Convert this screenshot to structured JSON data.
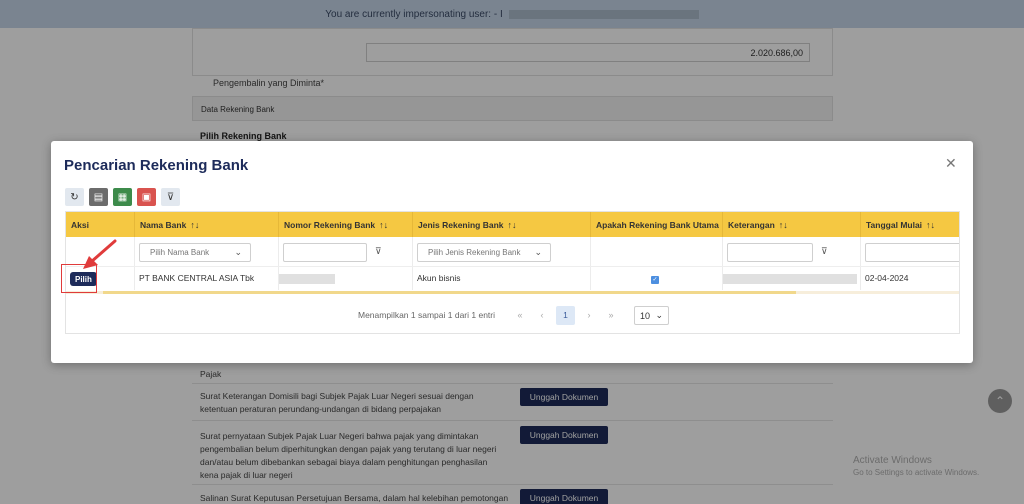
{
  "banner": {
    "text": "You are currently impersonating user: - I"
  },
  "background": {
    "field_label": "Pengembalin yang Diminta*",
    "field_value": "2.020.686,00",
    "section_title": "Data Rekening Bank",
    "section_subtitle": "Pilih Rekening Bank",
    "docs": [
      {
        "text": "Pajak",
        "button": ""
      },
      {
        "text": "Surat Keterangan Domisili bagi Subjek Pajak Luar Negeri sesuai dengan ketentuan peraturan perundang-undangan di bidang perpajakan",
        "button": "Unggah Dokumen"
      },
      {
        "text": "Surat pernyataan Subjek Pajak Luar Negeri bahwa pajak yang dimintakan pengembalian belum diperhitungkan dengan pajak yang terutang di luar negeri dan/atau belum dibebankan sebagai biaya dalam penghitungan penghasilan kena pajak di luar negeri",
        "button": "Unggah Dokumen"
      },
      {
        "text": "Salinan Surat Keputusan Persetujuan Bersama, dalam hal kelebihan pemotongan",
        "button": "Unggah Dokumen"
      }
    ],
    "watermark_title": "Activate Windows",
    "watermark_sub": "Go to Settings to activate Windows."
  },
  "modal": {
    "title": "Pencarian Rekening Bank",
    "close_icon": "close-icon",
    "toolbar": [
      "refresh-icon",
      "file-icon",
      "excel-icon",
      "pdf-icon",
      "filter-clear-icon"
    ],
    "columns": [
      {
        "label": "Aksi",
        "sortable": false
      },
      {
        "label": "Nama Bank",
        "sortable": true
      },
      {
        "label": "Nomor Rekening Bank",
        "sortable": true
      },
      {
        "label": "Jenis Rekening Bank",
        "sortable": true
      },
      {
        "label": "Apakah Rekening Bank Utama",
        "sortable": false
      },
      {
        "label": "Keterangan",
        "sortable": true
      },
      {
        "label": "Tanggal Mulai",
        "sortable": true
      }
    ],
    "filters": {
      "nama_bank_placeholder": "Pilih Nama Bank",
      "jenis_placeholder": "Pilih Jenis Rekening Bank"
    },
    "row": {
      "action": "Pilih",
      "nama_bank": "PT BANK CENTRAL ASIA Tbk",
      "jenis": "Akun bisnis",
      "utama": true,
      "tanggal_mulai": "02-04-2024"
    },
    "pager": {
      "info": "Menampilkan 1 sampai 1 dari 1 entri",
      "first": "«",
      "prev": "‹",
      "current": "1",
      "next": "›",
      "last": "»",
      "page_size": "10"
    }
  },
  "colors": {
    "header": "#f5c842",
    "brand": "#1d2b5a",
    "highlight": "#e03b3b"
  }
}
